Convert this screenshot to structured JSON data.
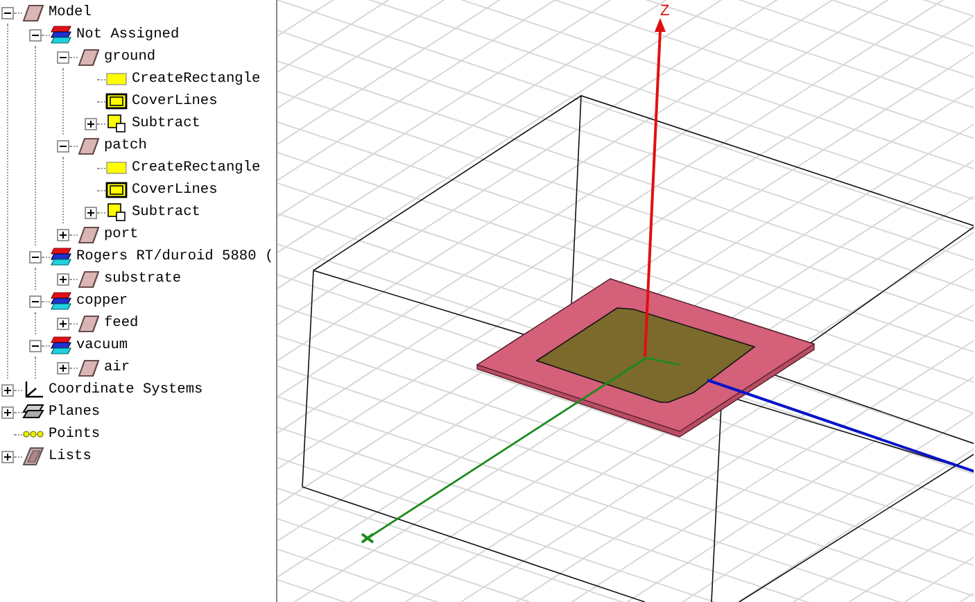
{
  "tree": [
    {
      "label": "Model",
      "kind": "object",
      "expanded": true,
      "children": [
        {
          "label": "Not Assigned",
          "kind": "material",
          "expanded": true,
          "children": [
            {
              "label": "ground",
              "kind": "object",
              "expanded": true,
              "children": [
                {
                  "label": "CreateRectangle",
                  "kind": "rectangle"
                },
                {
                  "label": "CoverLines",
                  "kind": "cover"
                },
                {
                  "label": "Subtract",
                  "kind": "subtract",
                  "expanded": false
                }
              ]
            },
            {
              "label": "patch",
              "kind": "object",
              "expanded": true,
              "children": [
                {
                  "label": "CreateRectangle",
                  "kind": "rectangle"
                },
                {
                  "label": "CoverLines",
                  "kind": "cover"
                },
                {
                  "label": "Subtract",
                  "kind": "subtract",
                  "expanded": false
                }
              ]
            },
            {
              "label": "port",
              "kind": "object",
              "expanded": false
            }
          ]
        },
        {
          "label": "Rogers RT/duroid 5880 (",
          "kind": "material",
          "expanded": true,
          "children": [
            {
              "label": "substrate",
              "kind": "object",
              "expanded": false
            }
          ]
        },
        {
          "label": "copper",
          "kind": "material",
          "expanded": true,
          "children": [
            {
              "label": "feed",
              "kind": "object",
              "expanded": false
            }
          ]
        },
        {
          "label": "vacuum",
          "kind": "material",
          "expanded": true,
          "children": [
            {
              "label": "air",
              "kind": "object",
              "expanded": false
            }
          ]
        }
      ]
    },
    {
      "label": "Coordinate Systems",
      "kind": "axes",
      "expanded": false
    },
    {
      "label": "Planes",
      "kind": "planes",
      "expanded": false
    },
    {
      "label": "Points",
      "kind": "points"
    },
    {
      "label": "Lists",
      "kind": "lists",
      "expanded": false
    }
  ],
  "viewport": {
    "axis_label": "Z"
  }
}
